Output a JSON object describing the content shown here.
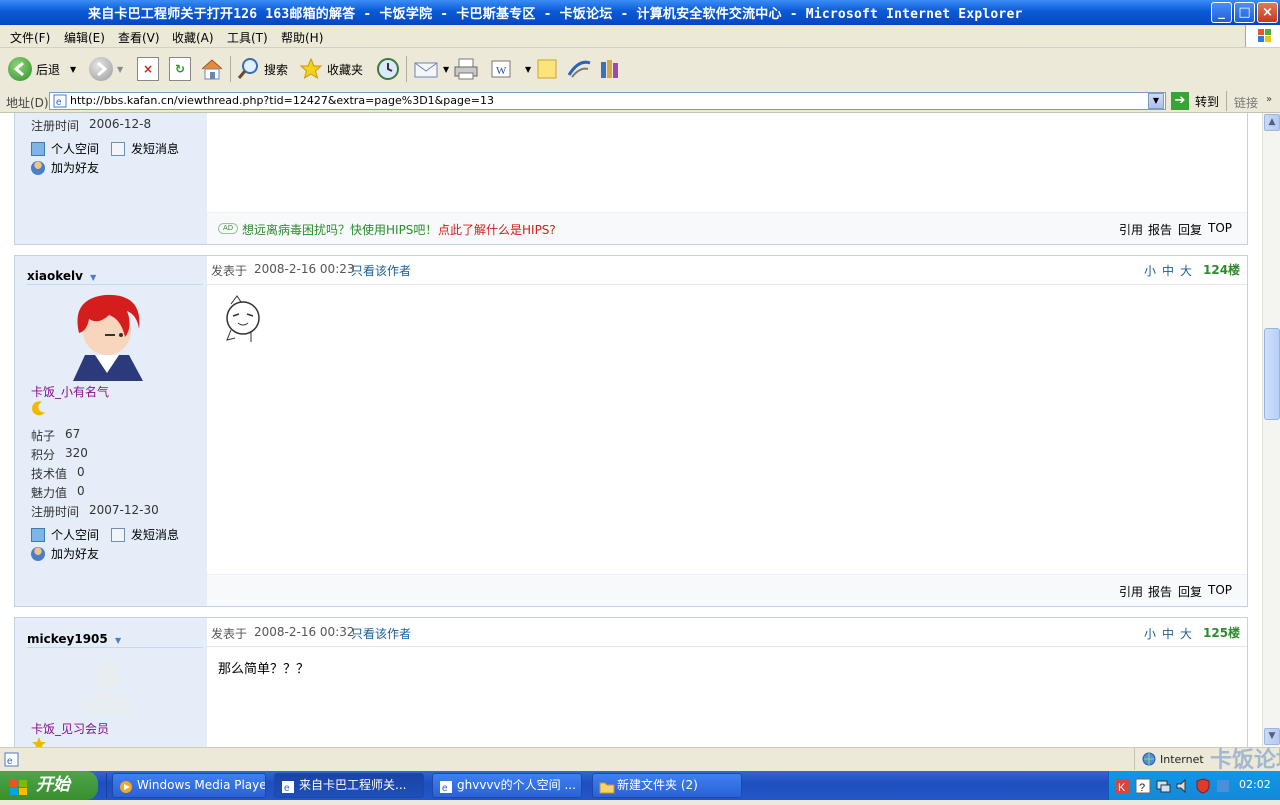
{
  "window": {
    "title": "来自卡巴工程师关于打开126 163邮箱的解答 - 卡饭学院 - 卡巴斯基专区 - 卡饭论坛 - 计算机安全软件交流中心 - Microsoft Internet Explorer",
    "min": "_",
    "max": "□",
    "close": "×"
  },
  "menu": [
    "文件(F)",
    "编辑(E)",
    "查看(V)",
    "收藏(A)",
    "工具(T)",
    "帮助(H)"
  ],
  "toolbar": {
    "back": "后退",
    "search": "搜索",
    "favorites": "收藏夹"
  },
  "address": {
    "label": "地址(D)",
    "url": "http://bbs.kafan.cn/viewthread.php?tid=12427&extra=page%3D1&page=13",
    "go": "转到",
    "links": "链接"
  },
  "prev_post": {
    "reg_label": "注册时间",
    "reg_value": "2006-12-8",
    "space": "个人空间",
    "pm": "发短消息",
    "friend": "加为好友",
    "ad_badge": "AD",
    "ad_green": "想远离病毒困扰吗？快使用HIPS吧！",
    "ad_red": "点此了解什么是HIPS?",
    "actions": [
      "引用",
      "报告",
      "回复",
      "TOP"
    ]
  },
  "post_124": {
    "username": "xiaokelv",
    "posted_label": "发表于",
    "date": "2008-2-16 00:23",
    "only_author": "只看该作者",
    "sizes": [
      "小",
      "中",
      "大"
    ],
    "floor": "124楼",
    "rank": "卡饭_小有名气",
    "stats": [
      {
        "label": "帖子",
        "value": "67"
      },
      {
        "label": "积分",
        "value": "320"
      },
      {
        "label": "技术值",
        "value": "0"
      },
      {
        "label": "魅力值",
        "value": "0"
      },
      {
        "label": "注册时间",
        "value": "2007-12-30"
      }
    ],
    "space": "个人空间",
    "pm": "发短消息",
    "friend": "加为好友",
    "actions": [
      "引用",
      "报告",
      "回复",
      "TOP"
    ]
  },
  "post_125": {
    "username": "mickey1905",
    "posted_label": "发表于",
    "date": "2008-2-16 00:32",
    "only_author": "只看该作者",
    "sizes": [
      "小",
      "中",
      "大"
    ],
    "floor": "125楼",
    "rank": "卡饭_见习会员",
    "body": "那么简单？？？"
  },
  "statusbar": {
    "zone": "Internet",
    "watermark": "卡饭论坛"
  },
  "taskbar": {
    "start": "开始",
    "tasks": [
      "Windows Media Player",
      "来自卡巴工程师关...",
      "ghvvvv的个人空间 ...",
      "新建文件夹 (2)"
    ],
    "time": "02:02"
  }
}
